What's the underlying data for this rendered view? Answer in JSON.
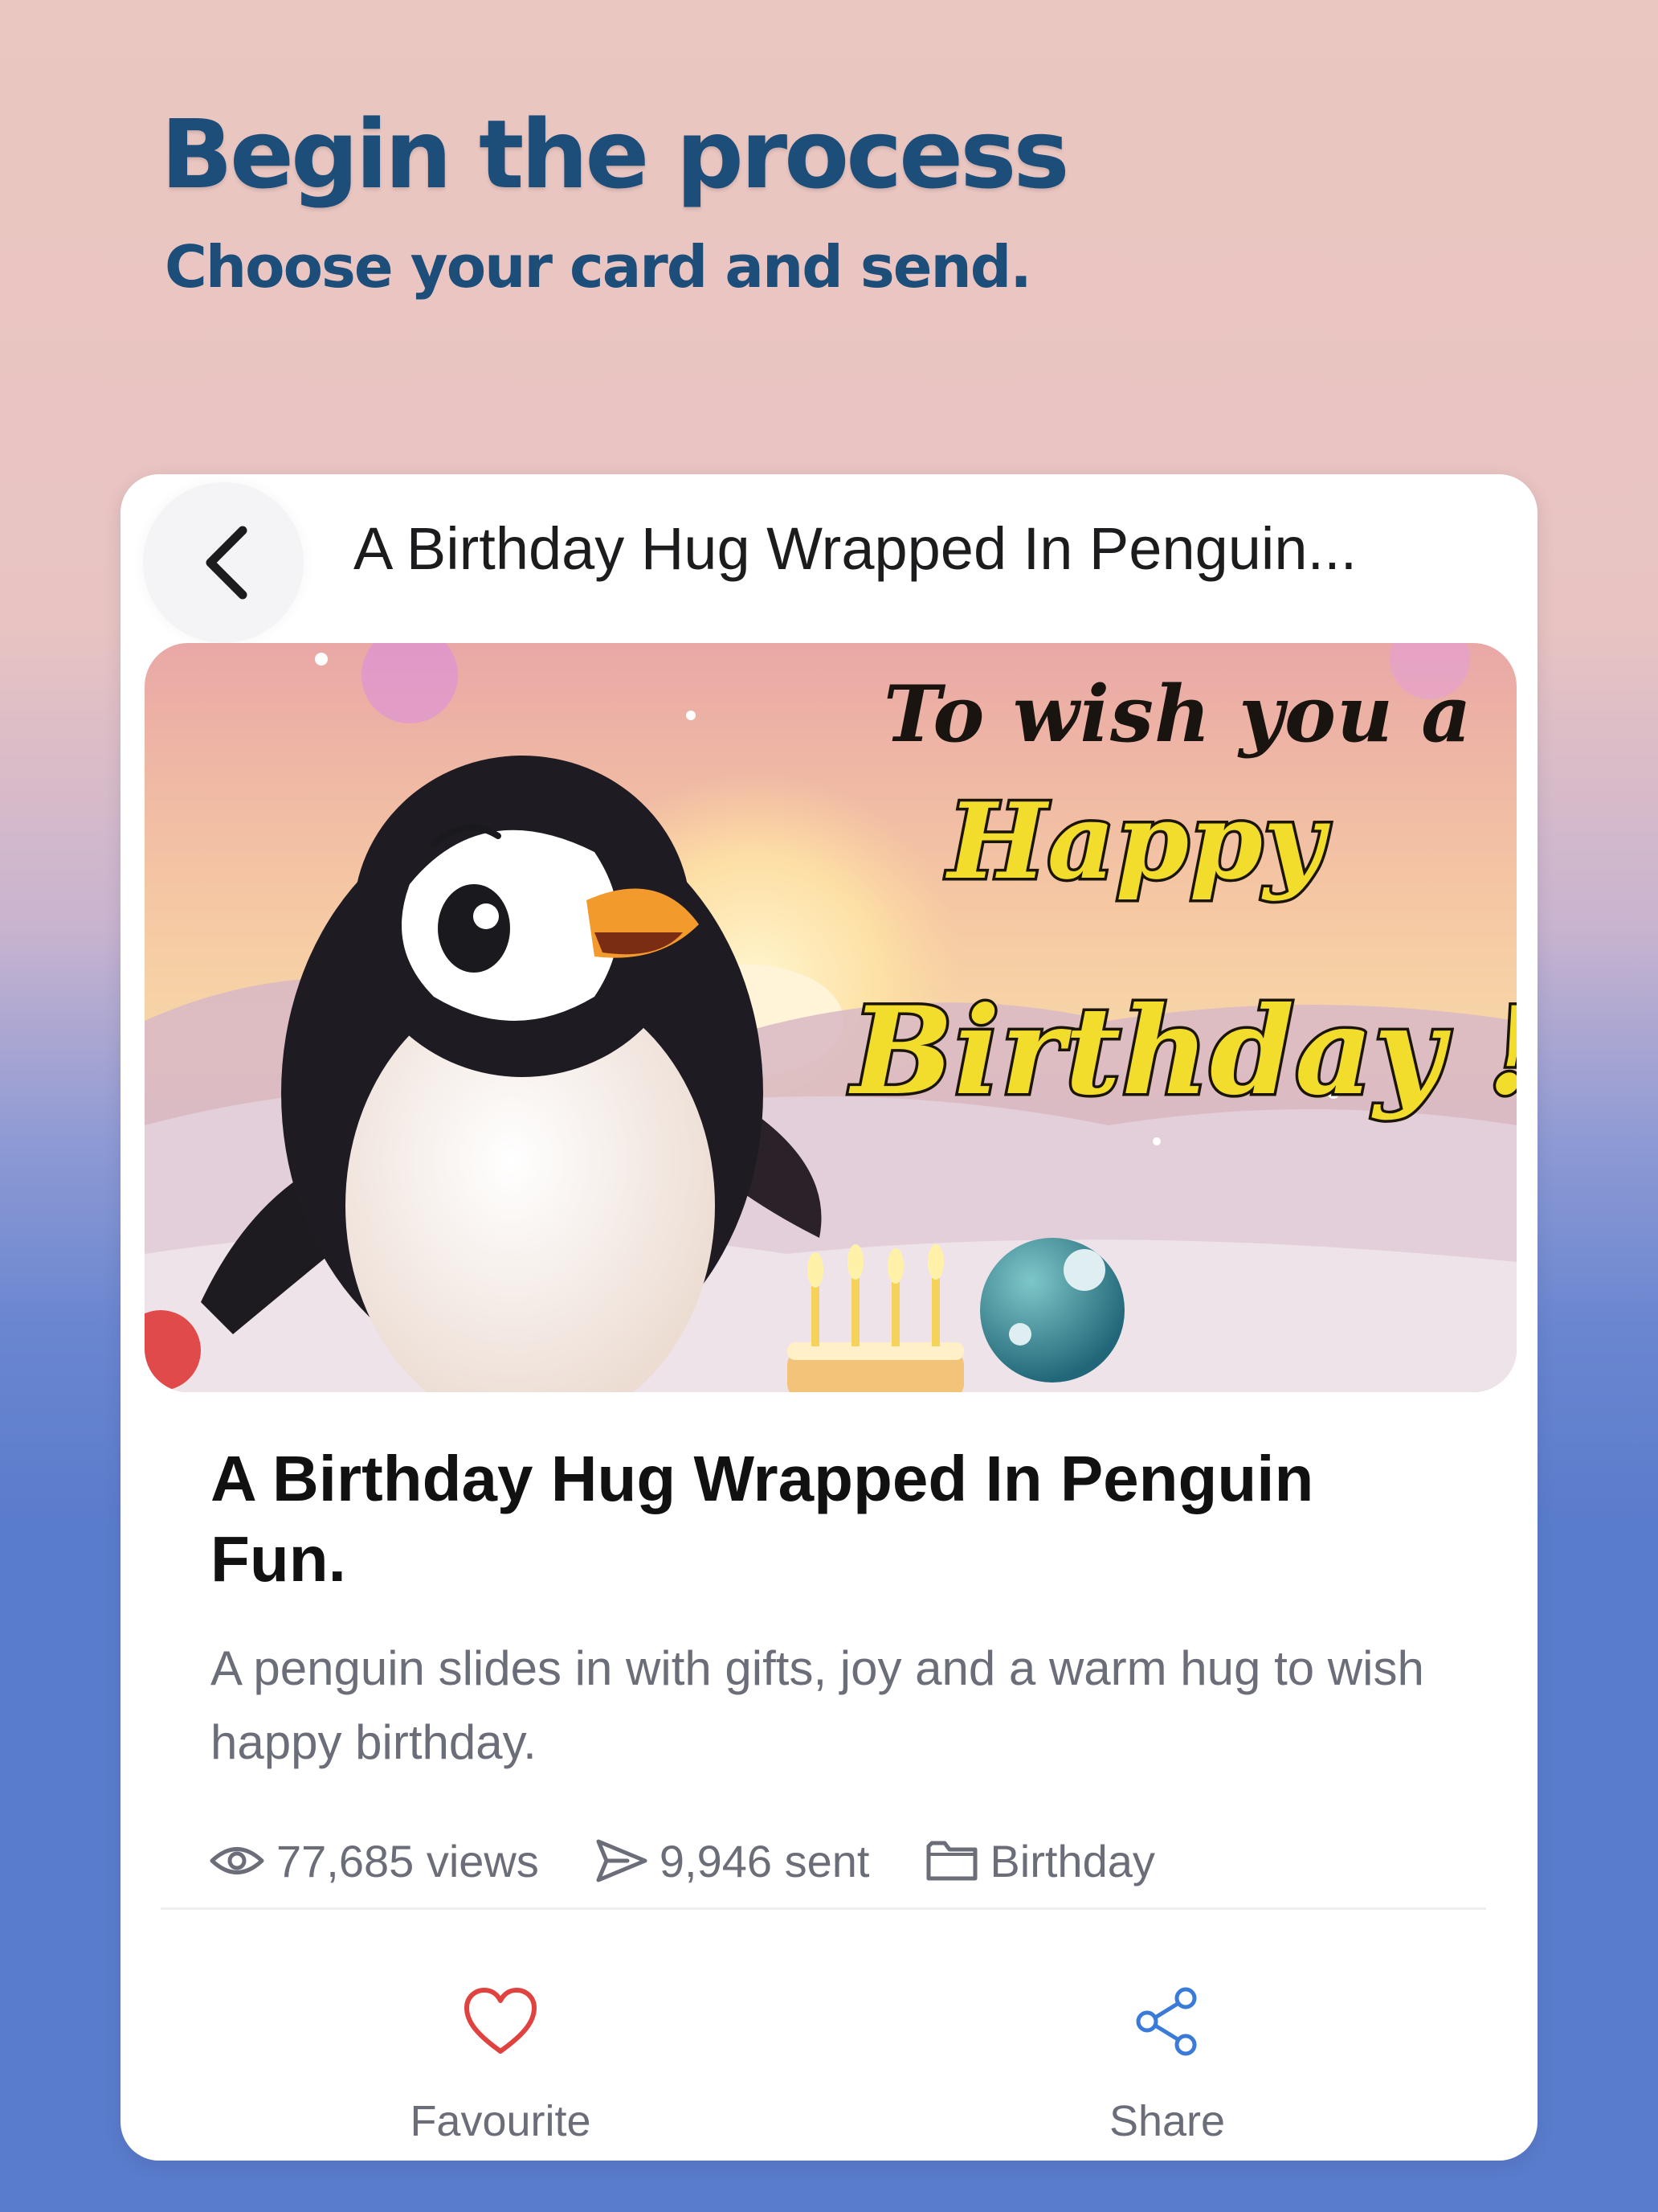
{
  "promo": {
    "headline": "Begin the process",
    "subheadline": "Choose your card and send."
  },
  "topbar": {
    "back_icon": "chevron-left-icon",
    "title": "A Birthday Hug Wrapped In Penguin..."
  },
  "hero": {
    "line1": "To wish you a",
    "line2": "Happy",
    "line3": "Birthday !"
  },
  "card": {
    "title": "A Birthday Hug Wrapped In Penguin Fun.",
    "description": "A penguin slides in with gifts, joy and a warm hug to wish happy birthday.",
    "views": "77,685 views",
    "sent": "9,946 sent",
    "category": "Birthday"
  },
  "actions": {
    "favourite_label": "Favourite",
    "share_label": "Share",
    "favourite_color": "#e0423f",
    "share_color": "#3a7ad8"
  },
  "colors": {
    "headline": "#1d4e7a",
    "yellow_text": "#f2dc2c"
  }
}
